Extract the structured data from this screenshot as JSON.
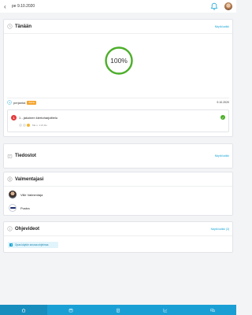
{
  "header": {
    "date": "pe 9.10.2020",
    "back_icon": "chevron-left-icon",
    "bell_icon": "bell-icon",
    "avatar_icon": "user-avatar"
  },
  "today": {
    "title": "Tänään",
    "link": "Näytä kaikki",
    "progress": "100%",
    "progress_fraction": 1.0,
    "event_name": "perjantai",
    "event_badge": "Aamu",
    "event_date": "9.10.2020",
    "task_number": "1",
    "task_title": "1 - jakoinen kiertoharjoittelu",
    "task_meta": "Ma o. 1:21 klo",
    "task_emojis": [
      "neutral",
      "neutral",
      "happy"
    ],
    "colors": {
      "ring": "#4caf2a",
      "badge": "#f3a530",
      "task_num": "#e33b3b"
    }
  },
  "files": {
    "title": "Tiedostot",
    "link": "Näytä kaikki"
  },
  "coaches": {
    "title": "Valmentajasi",
    "items": [
      {
        "name": "Ville Valmentaja",
        "type": "person"
      },
      {
        "name": "Pustra",
        "type": "logo"
      }
    ]
  },
  "guides": {
    "title": "Ohjevideot",
    "link": "Näytä kaikki (3)",
    "button_label": "Opas käytön seuraa ohjelmaa"
  },
  "bottom_nav": {
    "accent": "#1a9fd4",
    "tabs": [
      {
        "icon": "home-icon",
        "active": true
      },
      {
        "icon": "calendar-icon",
        "active": false
      },
      {
        "icon": "clipboard-icon",
        "active": false
      },
      {
        "icon": "chart-icon",
        "active": false
      },
      {
        "icon": "chat-icon",
        "active": false
      }
    ]
  }
}
